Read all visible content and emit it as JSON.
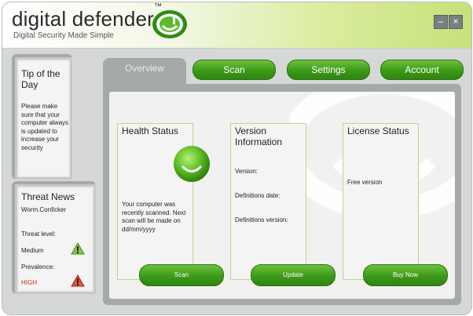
{
  "app": {
    "brand": "digital defender",
    "brand_tm": "™",
    "tagline": "Digital Security Made Simple",
    "minimize_label": "–",
    "close_label": "×"
  },
  "tabs": {
    "overview": "Overview",
    "scan": "Scan",
    "settings": "Settings",
    "account": "Account"
  },
  "tip": {
    "title": "Tip of the Day",
    "text": "Please make sure that your computer always is updated to increase your security"
  },
  "news": {
    "title": "Threat News",
    "item": "Worm.Conficker",
    "threat_level_label": "Threat level:",
    "threat_level_value": "Medium",
    "prevalence_label": "Prevalence:",
    "prevalence_value": "HIGH",
    "prevalence_color": "#d22a1a"
  },
  "health": {
    "title": "Health Status",
    "text": "Your computer was recently scanned. Next scan will be made on dd/mm/yyyy",
    "button": "Scan"
  },
  "version": {
    "title_line1": "Version",
    "title_line2": "Information",
    "version_label": "Version:",
    "definitions_date_label": "Definitions date:",
    "definitions_version_label": "Definitions version:",
    "button": "Update"
  },
  "license": {
    "title": "License Status",
    "text": "Free version",
    "button": "Buy Now"
  },
  "colors": {
    "accent_green": "#3c9a18",
    "frame_gray": "#a6a9aa"
  }
}
